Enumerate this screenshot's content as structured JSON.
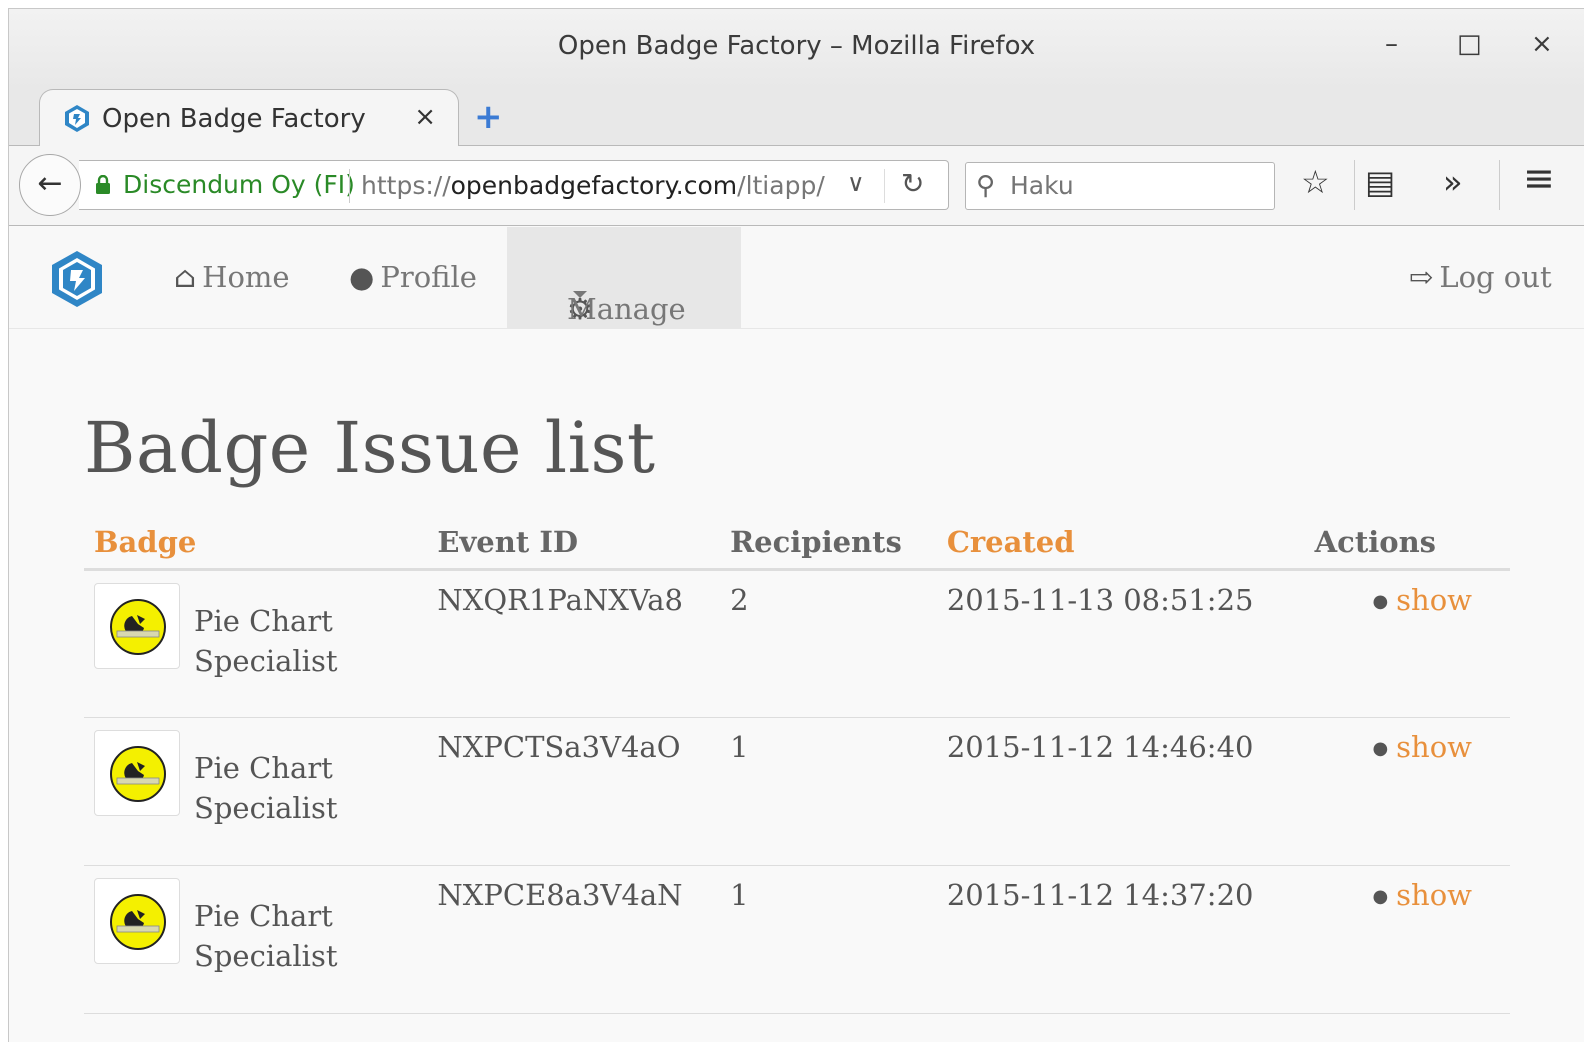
{
  "window": {
    "title": "Open Badge Factory – Mozilla Firefox",
    "minimize": "–",
    "maximize": "□",
    "close": "×"
  },
  "tab": {
    "label": "Open Badge Factory",
    "close": "×",
    "new_tab": "+"
  },
  "navbar": {
    "back": "←",
    "identity": "Discendum Oy (FI)",
    "url_scheme": "https://",
    "url_domain": "openbadgefactory.com",
    "url_path": "/ltiapp/",
    "dropdown": "∨",
    "reload": "↻",
    "search_placeholder": "Haku",
    "bookmark": "☆",
    "reader": "▤",
    "overflow": "»",
    "menu": "≡"
  },
  "site_nav": {
    "home": "Home",
    "profile": "Profile",
    "manage": "Manage",
    "logout": "Log out"
  },
  "page": {
    "title": "Badge Issue list"
  },
  "table": {
    "headers": {
      "badge": "Badge",
      "event_id": "Event ID",
      "recipients": "Recipients",
      "created": "Created",
      "actions": "Actions"
    },
    "rows": [
      {
        "badge_line1": "Pie Chart",
        "badge_line2": "Specialist",
        "event_id": "NXQR1PaNXVa8",
        "recipients": "2",
        "created": "2015-11-13 08:51:25",
        "action": "show"
      },
      {
        "badge_line1": "Pie Chart",
        "badge_line2": "Specialist",
        "event_id": "NXPCTSa3V4aO",
        "recipients": "1",
        "created": "2015-11-12 14:46:40",
        "action": "show"
      },
      {
        "badge_line1": "Pie Chart",
        "badge_line2": "Specialist",
        "event_id": "NXPCE8a3V4aN",
        "recipients": "1",
        "created": "2015-11-12 14:37:20",
        "action": "show"
      }
    ]
  },
  "colors": {
    "accent": "#e8903c",
    "identity_green": "#2a8a27",
    "logo_blue": "#2f86c6",
    "badge_yellow": "#f4f000"
  }
}
